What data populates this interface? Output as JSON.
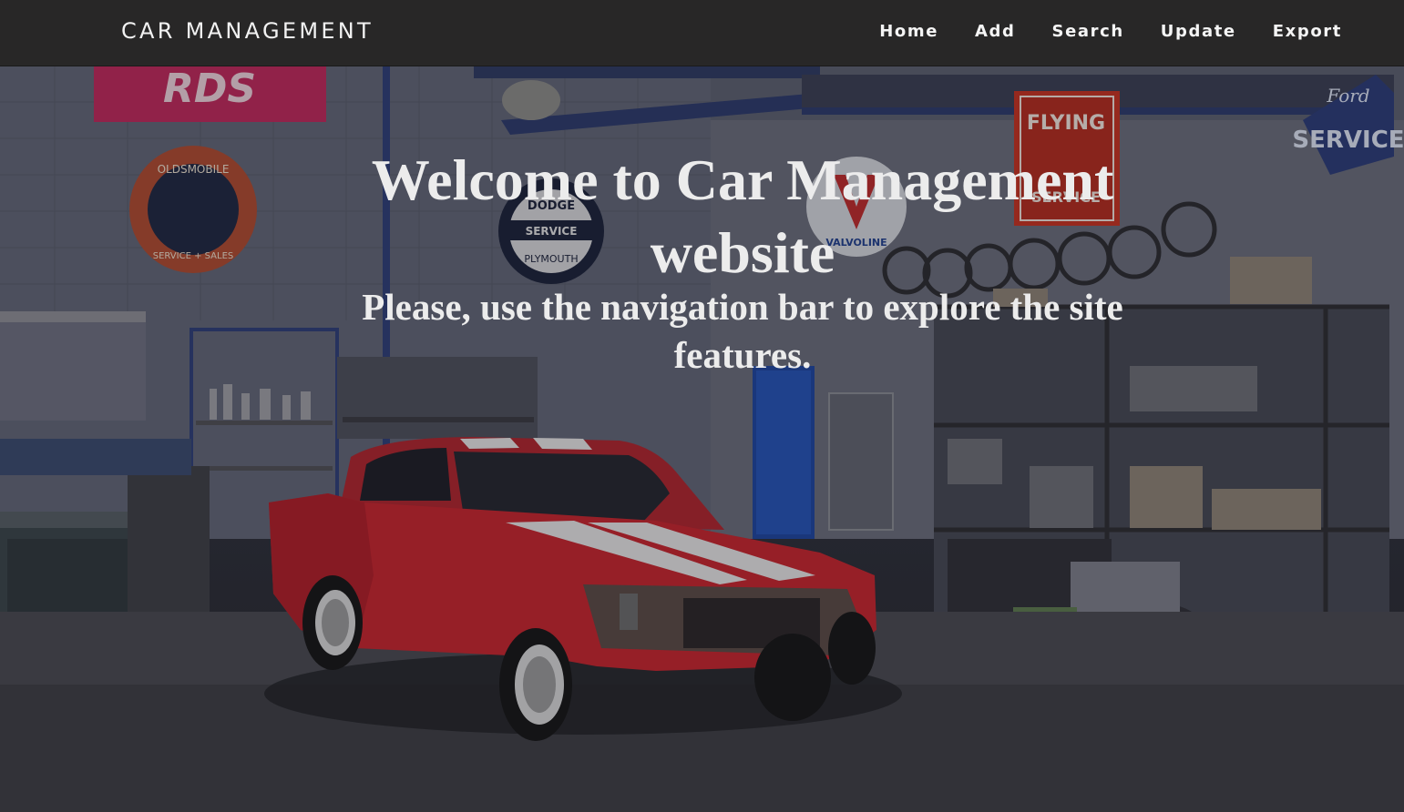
{
  "brand": {
    "name": "CAR MANAGEMENT"
  },
  "nav": {
    "items": [
      {
        "label": "Home"
      },
      {
        "label": "Add"
      },
      {
        "label": "Search"
      },
      {
        "label": "Update"
      },
      {
        "label": "Export"
      }
    ]
  },
  "hero": {
    "title_line1": "Welcome to Car Management",
    "title_line2": "website",
    "subtitle_line1": "Please, use the navigation bar to explore the site",
    "subtitle_line2": "features.",
    "background": "garage-with-red-car-photo"
  },
  "colors": {
    "navbar_bg": "#282727",
    "nav_text": "#f5f5f5",
    "hero_text": "#ececec",
    "car_red": "#c8232c",
    "stripe_white": "#e8e6e6"
  },
  "signs": {
    "banner": "RDS",
    "oldsmobile_top": "OLDSMOBILE",
    "oldsmobile_bottom": "SERVICE + SALES",
    "dodge_top": "DODGE",
    "dodge_mid": "SERVICE",
    "dodge_bottom": "PLYMOUTH",
    "valvoline": "VALVOLINE",
    "flying_a_top": "FLYING",
    "flying_a_bottom": "SERVICE",
    "ford_top": "Ford",
    "ford_bottom": "SERVICE"
  }
}
